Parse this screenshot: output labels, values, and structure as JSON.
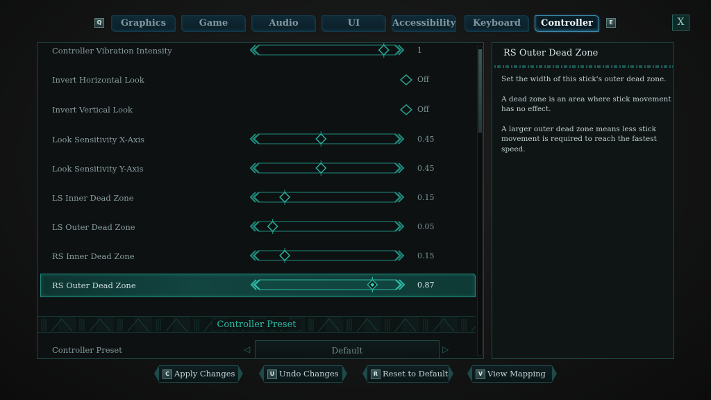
{
  "tabs": {
    "prev_key": "Q",
    "next_key": "E",
    "items": [
      {
        "label": "Graphics",
        "active": false
      },
      {
        "label": "Game",
        "active": false
      },
      {
        "label": "Audio",
        "active": false
      },
      {
        "label": "UI",
        "active": false
      },
      {
        "label": "Accessibility",
        "active": false
      },
      {
        "label": "Keyboard",
        "active": false
      },
      {
        "label": "Controller",
        "active": true
      }
    ],
    "close_label": "X"
  },
  "settings": [
    {
      "label": "Controller Vibration Intensity",
      "type": "slider",
      "value": "1",
      "fraction": 0.97
    },
    {
      "label": "Invert Horizontal Look",
      "type": "toggle",
      "value": "Off"
    },
    {
      "label": "Invert Vertical Look",
      "type": "toggle",
      "value": "Off"
    },
    {
      "label": "Look Sensitivity X-Axis",
      "type": "slider",
      "value": "0.45",
      "fraction": 0.45
    },
    {
      "label": "Look Sensitivity Y-Axis",
      "type": "slider",
      "value": "0.45",
      "fraction": 0.45
    },
    {
      "label": "LS Inner Dead Zone",
      "type": "slider",
      "value": "0.15",
      "fraction": 0.15
    },
    {
      "label": "LS Outer Dead Zone",
      "type": "slider",
      "value": "0.05",
      "fraction": 0.05
    },
    {
      "label": "RS Inner Dead Zone",
      "type": "slider",
      "value": "0.15",
      "fraction": 0.15
    },
    {
      "label": "RS Outer Dead Zone",
      "type": "slider",
      "value": "0.87",
      "fraction": 0.87,
      "selected": true
    }
  ],
  "section": {
    "title": "Controller Preset"
  },
  "preset": {
    "label": "Controller Preset",
    "value": "Default"
  },
  "scroll": {
    "position_fraction": 0.0,
    "visible_fraction": 0.27
  },
  "info": {
    "title": "RS Outer Dead Zone",
    "paragraphs": [
      "Set the width of this stick's outer dead zone.",
      "A dead zone is an area where stick movement has no effect.",
      "A larger outer dead zone means less stick movement is required to reach the fastest speed."
    ]
  },
  "footer": {
    "buttons": [
      {
        "key": "C",
        "label": "Apply Changes"
      },
      {
        "key": "U",
        "label": "Undo Changes"
      },
      {
        "key": "R",
        "label": "Reset to Default"
      },
      {
        "key": "V",
        "label": "View Mapping"
      }
    ]
  },
  "colors": {
    "accent": "#2dbba5",
    "slider_line": "#1f8a7c",
    "panel_border": "#1f4a46",
    "active_tab_border": "#3d8ab0"
  }
}
